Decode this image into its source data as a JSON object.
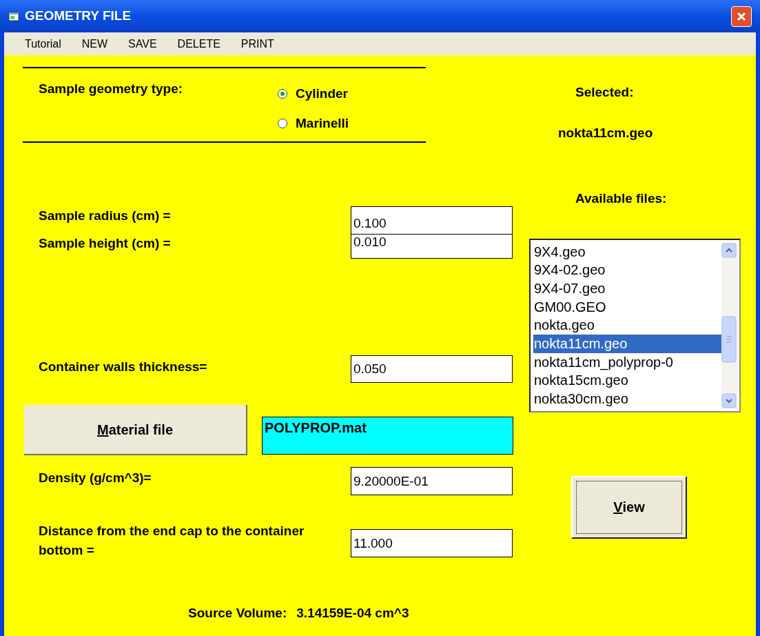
{
  "window": {
    "title": "GEOMETRY FILE"
  },
  "menu": [
    {
      "label": "Tutorial"
    },
    {
      "label": "NEW"
    },
    {
      "label": "SAVE"
    },
    {
      "label": "DELETE"
    },
    {
      "label": "PRINT"
    }
  ],
  "geometry_type": {
    "label": "Sample geometry type:",
    "options": [
      {
        "label": "Cylinder",
        "selected": true
      },
      {
        "label": "Marinelli",
        "selected": false
      }
    ]
  },
  "selected": {
    "label": "Selected:",
    "value": "nokta11cm.geo"
  },
  "available_files": {
    "label": "Available files:",
    "items": [
      {
        "label": "9X4.geo",
        "selected": false
      },
      {
        "label": "9X4-02.geo",
        "selected": false
      },
      {
        "label": "9X4-07.geo",
        "selected": false
      },
      {
        "label": "GM00.GEO",
        "selected": false
      },
      {
        "label": "nokta.geo",
        "selected": false
      },
      {
        "label": "nokta11cm.geo",
        "selected": true
      },
      {
        "label": "nokta11cm_polyprop-0",
        "selected": false
      },
      {
        "label": "nokta15cm.geo",
        "selected": false
      },
      {
        "label": "nokta30cm.geo",
        "selected": false
      }
    ]
  },
  "radius": {
    "label": "Sample radius (cm) =",
    "value": "0.100"
  },
  "height": {
    "label": "Sample height (cm) =",
    "value": "0.010"
  },
  "walls": {
    "label": "Container walls thickness=",
    "value": "0.050"
  },
  "material": {
    "button": "Material file",
    "value": "POLYPROP.mat"
  },
  "density": {
    "label": "Density (g/cm^3)=",
    "value": "9.20000E-01"
  },
  "distance": {
    "label": "Distance from the end cap to the container bottom =",
    "value": "11.000"
  },
  "view_button": {
    "label": "View",
    "focused": true
  },
  "source_volume": {
    "label": "Source Volume:",
    "value": "3.14159E-04 cm^3"
  }
}
